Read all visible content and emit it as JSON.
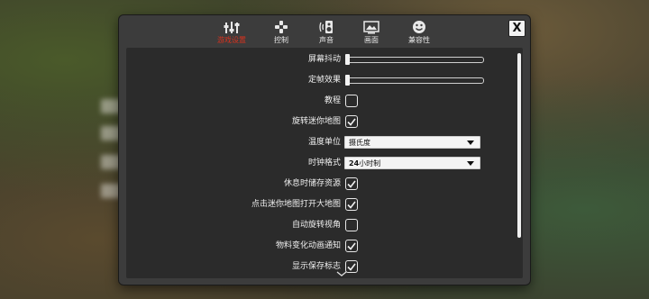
{
  "tabs": [
    {
      "label": "游戏设置",
      "icon": "wrench-settings-icon",
      "active": true
    },
    {
      "label": "控制",
      "icon": "gamepad-icon",
      "active": false
    },
    {
      "label": "声音",
      "icon": "speaker-icon",
      "active": false
    },
    {
      "label": "画面",
      "icon": "monitor-icon",
      "active": false
    },
    {
      "label": "兼容性",
      "icon": "smiley-icon",
      "active": false
    }
  ],
  "close_label": "X",
  "settings": {
    "screen_shake": {
      "label": "屏幕抖动",
      "value": 0
    },
    "frame_freeze": {
      "label": "定帧效果",
      "value": 0
    },
    "tutorial": {
      "label": "教程",
      "checked": false
    },
    "rotate_minimap": {
      "label": "旋转迷你地图",
      "checked": true
    },
    "temperature_unit": {
      "label": "温度单位",
      "value": "摄氏度"
    },
    "clock_format": {
      "label": "时钟格式",
      "value": "24小时制",
      "value_prefix": "24",
      "value_suffix": "小时制"
    },
    "save_on_pause": {
      "label": "休息时储存资源",
      "checked": true
    },
    "minimap_click_map": {
      "label": "点击迷你地图打开大地图",
      "checked": true
    },
    "auto_rotate_view": {
      "label": "自动旋转视角",
      "checked": false
    },
    "material_change_anim": {
      "label": "物料变化动画通知",
      "checked": true
    },
    "show_save_indicator": {
      "label": "显示保存标志",
      "checked": true
    }
  },
  "colors": {
    "active_tab": "#d8321e",
    "panel": "#3c3c3c",
    "content": "#2b2b2b",
    "text": "#f0f0f0"
  }
}
